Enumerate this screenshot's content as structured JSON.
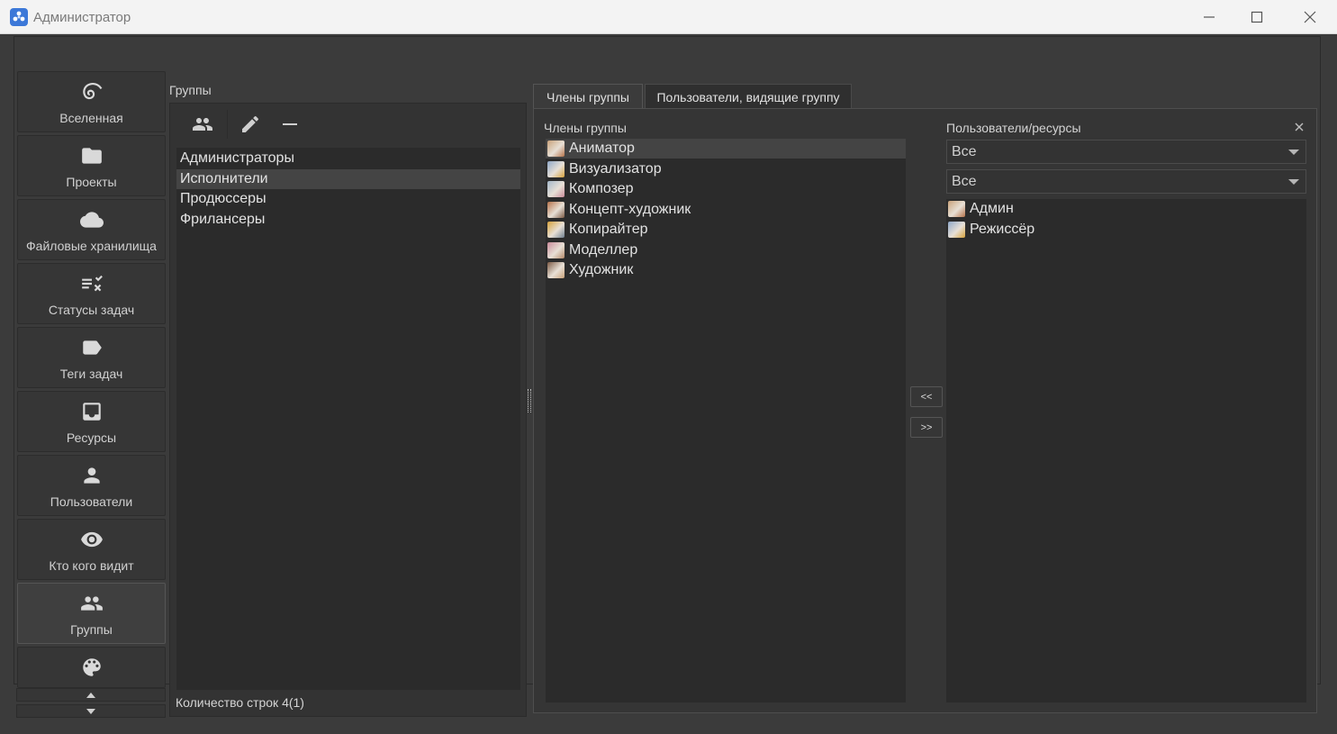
{
  "window": {
    "title": "Администратор"
  },
  "nav": {
    "items": [
      {
        "label": "Вселенная",
        "icon": "spiral-icon"
      },
      {
        "label": "Проекты",
        "icon": "folder-icon"
      },
      {
        "label": "Файловые хранилища",
        "icon": "cloud-icon"
      },
      {
        "label": "Статусы задач",
        "icon": "task-status-icon"
      },
      {
        "label": "Теги задач",
        "icon": "tag-icon"
      },
      {
        "label": "Ресурсы",
        "icon": "inbox-icon"
      },
      {
        "label": "Пользователи",
        "icon": "person-icon"
      },
      {
        "label": "Кто кого видит",
        "icon": "eye-icon"
      },
      {
        "label": "Группы",
        "icon": "people-icon",
        "active": true
      },
      {
        "label": "",
        "icon": "palette-icon"
      }
    ]
  },
  "groups": {
    "label": "Группы",
    "items": [
      "Администраторы",
      "Исполнители",
      "Продюссеры",
      "Фрилансеры"
    ],
    "selected_index": 1,
    "row_count": "Количество строк 4(1)"
  },
  "tabs": [
    {
      "label": "Члены группы",
      "active": true
    },
    {
      "label": "Пользователи, видящие группу",
      "active": false
    }
  ],
  "members": {
    "label": "Члены группы",
    "items": [
      "Аниматор",
      "Визуализатор",
      "Композер",
      "Концепт-художник",
      "Копирайтер",
      "Моделлер",
      "Художник"
    ],
    "selected_index": 0
  },
  "users_resources": {
    "label": "Пользователи/ресурсы",
    "filter1": "Все",
    "filter2": "Все",
    "items": [
      "Админ",
      "Режиссёр"
    ]
  },
  "buttons": {
    "add": "<<",
    "remove": ">>"
  }
}
